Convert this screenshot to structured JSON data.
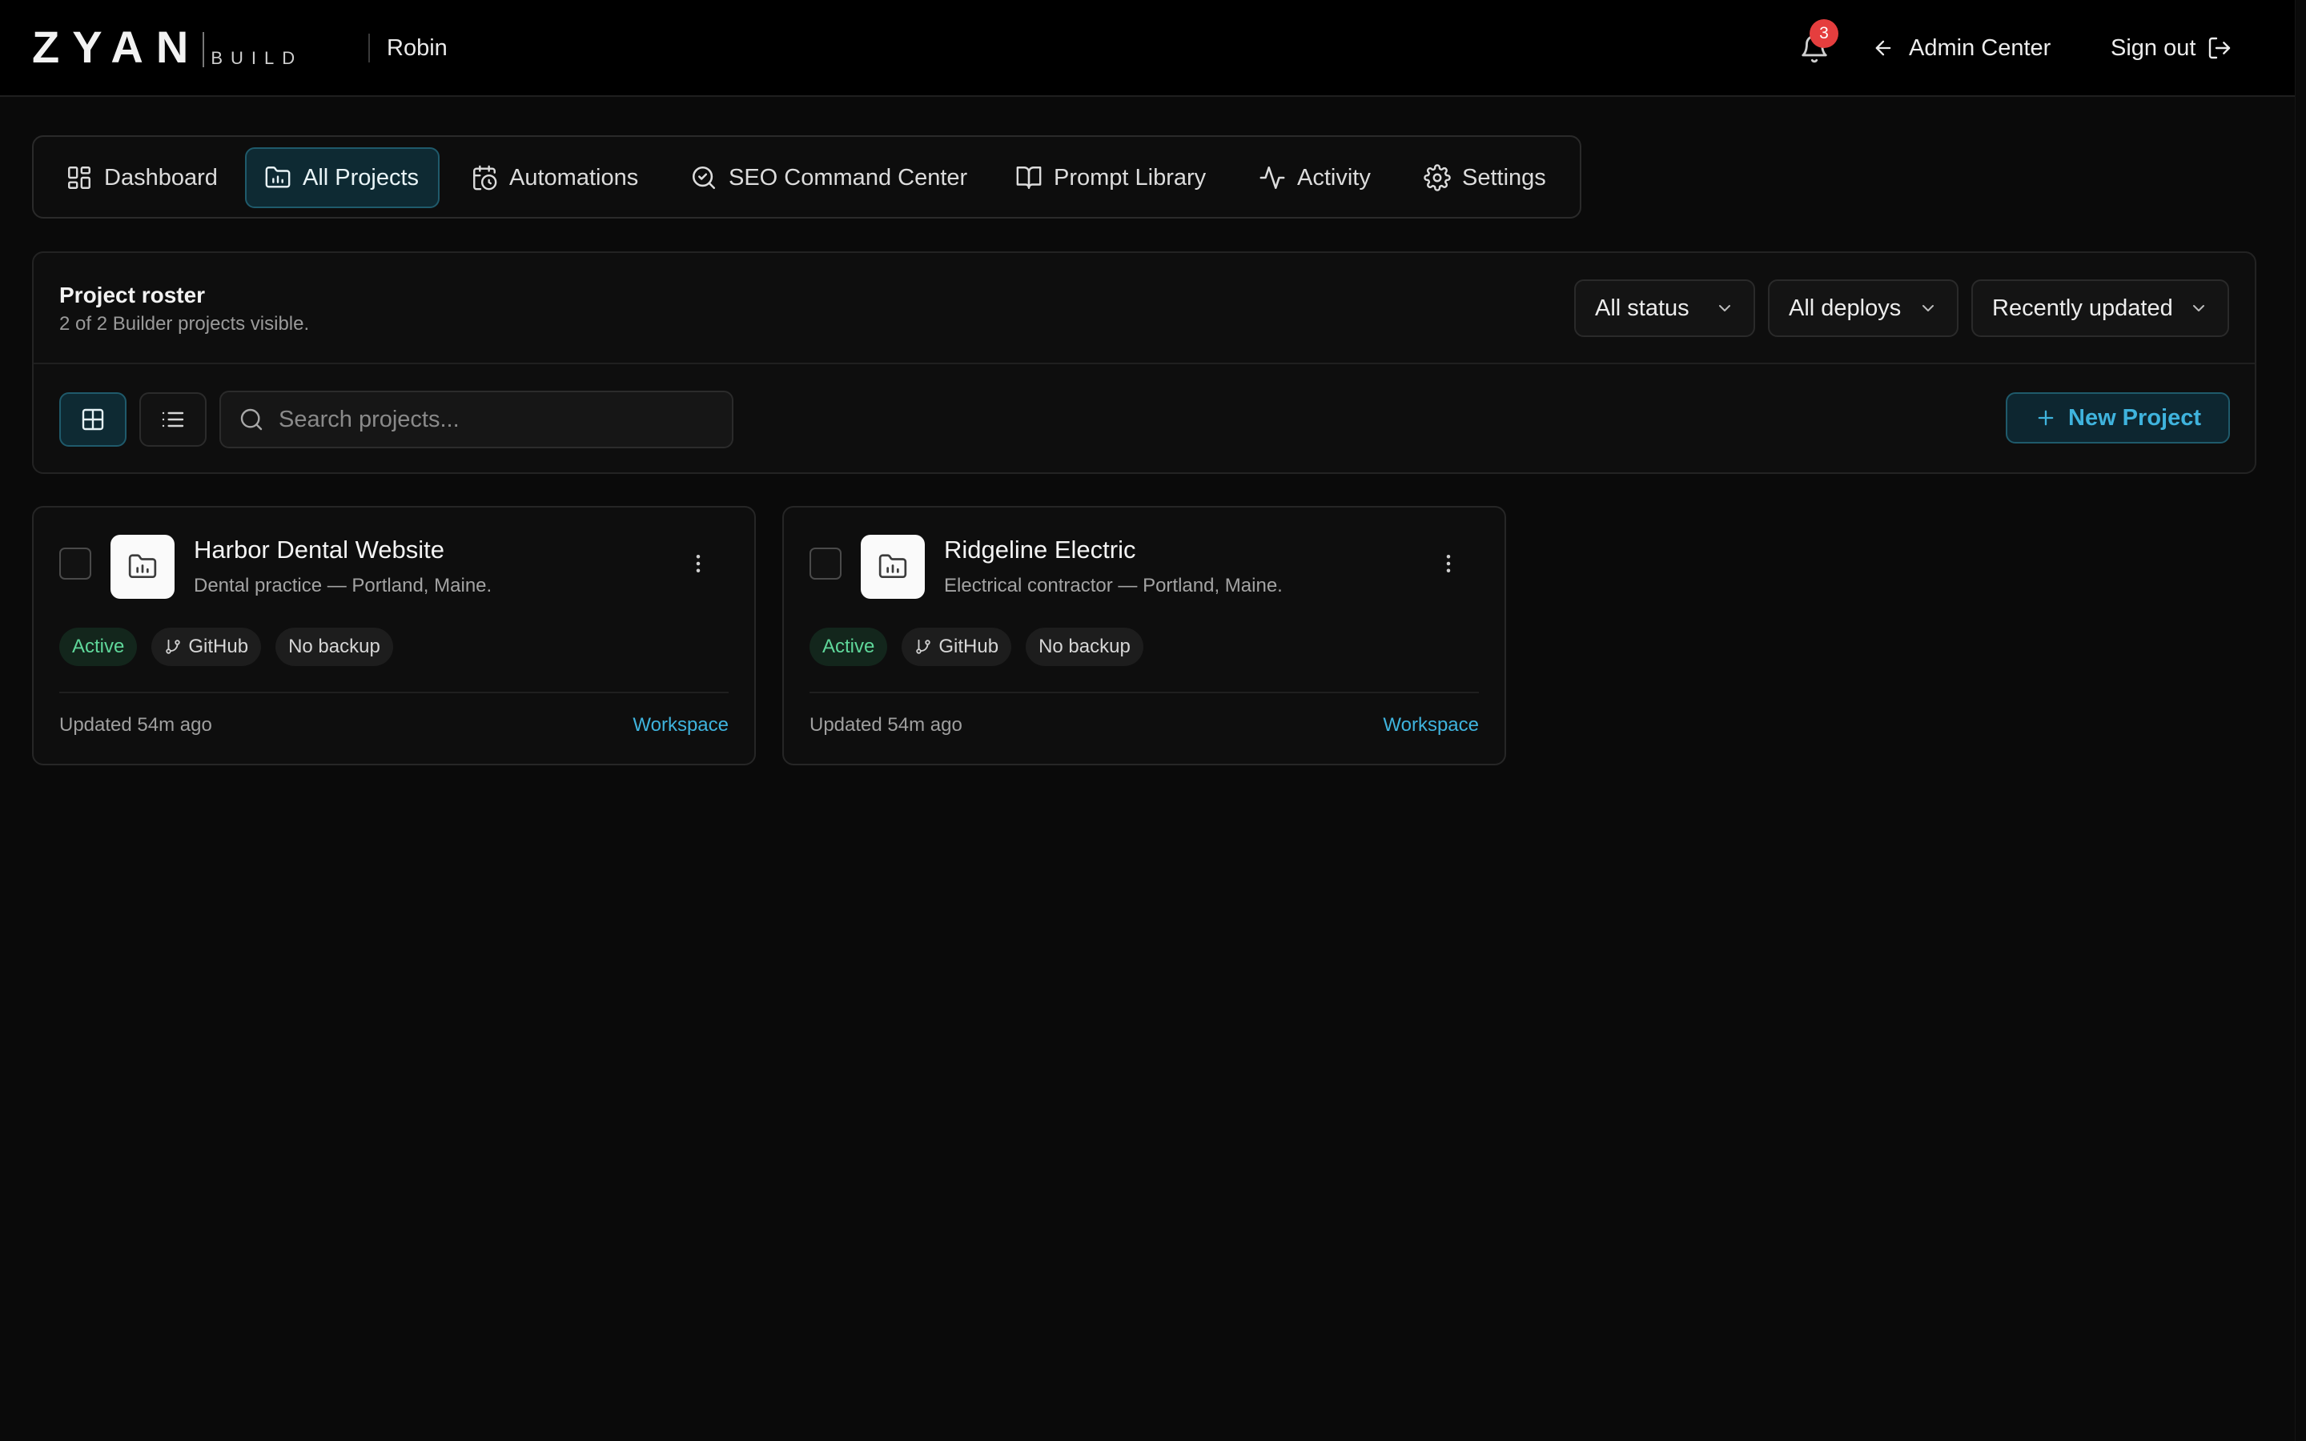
{
  "header": {
    "logo_word": "ZYAN",
    "logo_sub": "BUILD",
    "user": "Robin",
    "notifications_count": "3",
    "admin_label": "Admin Center",
    "signout_label": "Sign out"
  },
  "nav": {
    "tabs": [
      {
        "label": "Dashboard",
        "icon": "dashboard-icon"
      },
      {
        "label": "All Projects",
        "icon": "folder-chart-icon",
        "active": true
      },
      {
        "label": "Automations",
        "icon": "calendar-clock-icon"
      },
      {
        "label": "SEO Command Center",
        "icon": "search-check-icon"
      },
      {
        "label": "Prompt Library",
        "icon": "book-open-icon"
      },
      {
        "label": "Activity",
        "icon": "activity-icon"
      },
      {
        "label": "Settings",
        "icon": "gear-icon"
      }
    ]
  },
  "roster": {
    "title": "Project roster",
    "subtitle": "2 of 2 Builder projects visible.",
    "filters": {
      "status": "All status",
      "deploys": "All deploys",
      "sort": "Recently updated"
    },
    "search_placeholder": "Search projects...",
    "new_project_label": "New Project"
  },
  "projects": [
    {
      "name": "Harbor Dental Website",
      "description": "Dental practice — Portland, Maine.",
      "status": "Active",
      "repo": "GitHub",
      "backup": "No backup",
      "updated": "Updated 54m ago",
      "link": "Workspace"
    },
    {
      "name": "Ridgeline Electric",
      "description": "Electrical contractor — Portland, Maine.",
      "status": "Active",
      "repo": "GitHub",
      "backup": "No backup",
      "updated": "Updated 54m ago",
      "link": "Workspace"
    }
  ],
  "colors": {
    "background": "#0a0a0a",
    "accent": "#3fb3dd",
    "active_tab_bg": "#0e2a33",
    "status_green": "#5fd79a",
    "badge_red": "#e53e3e"
  }
}
